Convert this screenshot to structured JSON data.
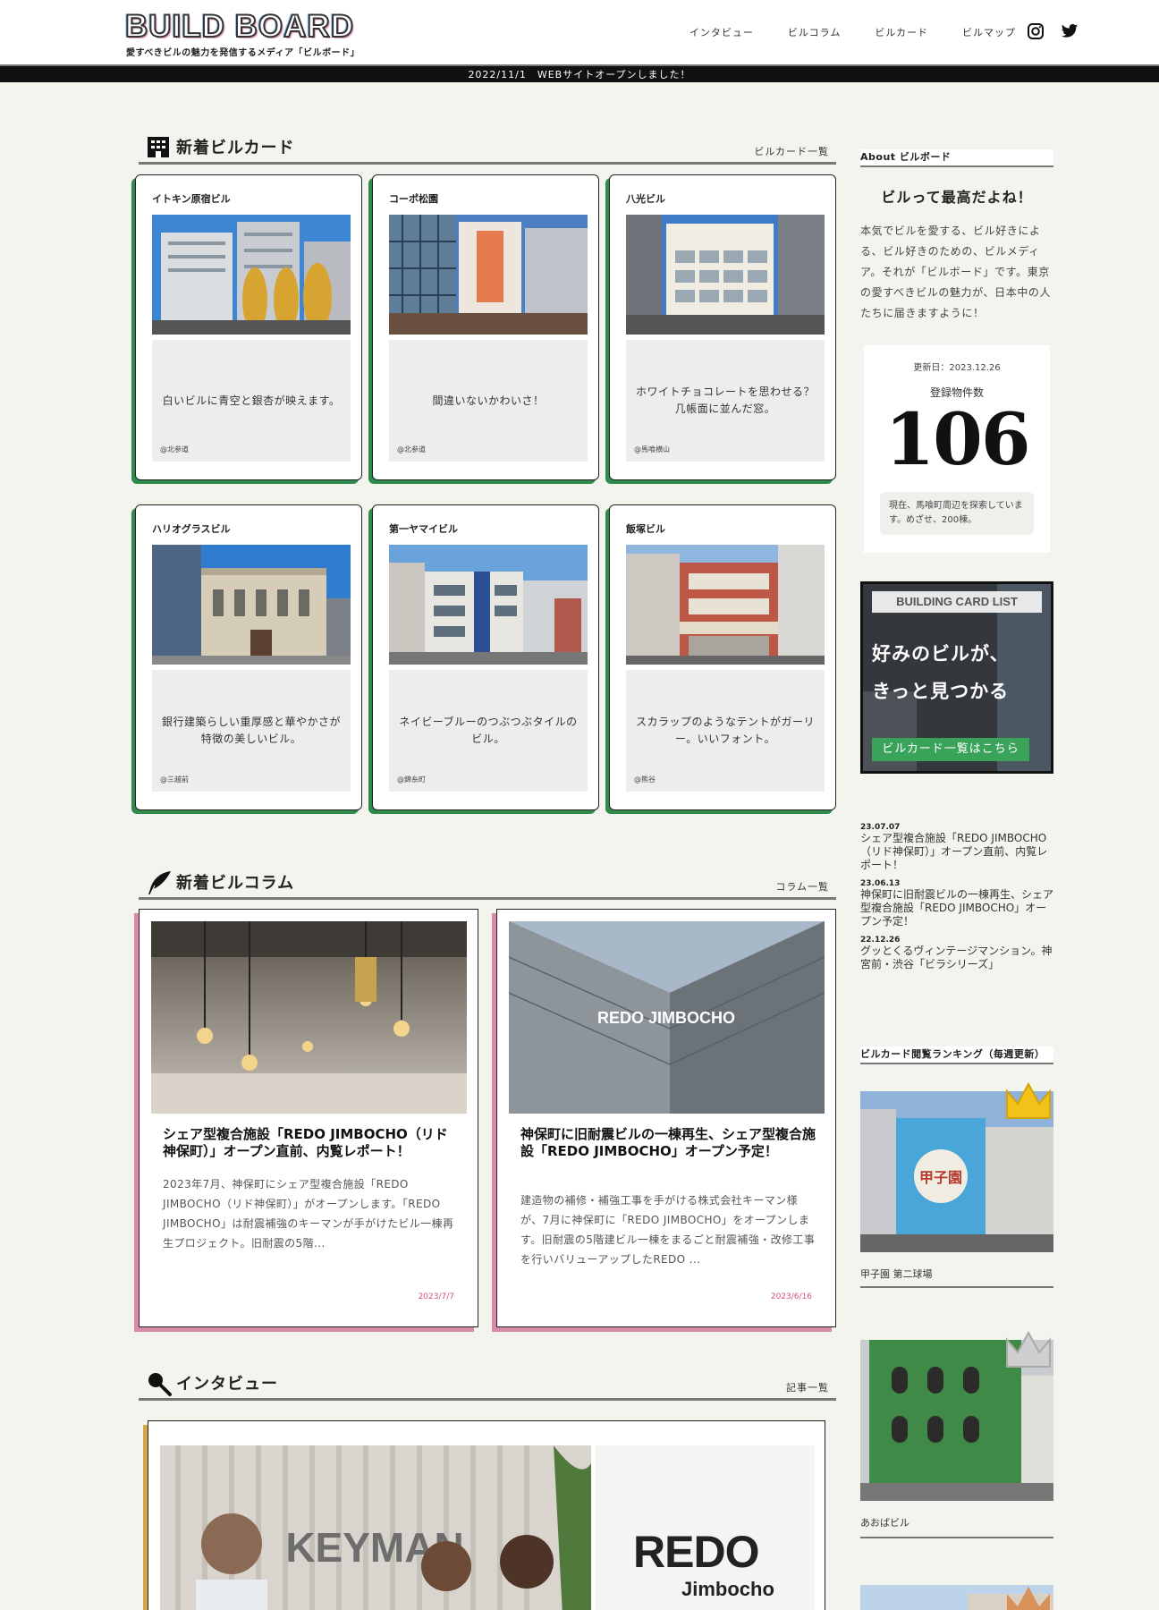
{
  "header": {
    "logo": "BUILD BOARD",
    "tagline": "愛すべきビルの魅力を発信するメディア「ビルボード」",
    "nav": [
      "インタビュー",
      "ビルコラム",
      "ビルカード",
      "ビルマップ"
    ],
    "announcement": "2022/11/1　WEBサイトオープンしました！"
  },
  "cards_section": {
    "title": "新着ビルカード",
    "more": "ビルカード一覧",
    "cards": [
      {
        "name": "イトキン原宿ビル",
        "desc": "白いビルに青空と銀杏が映えます。",
        "loc": "@北参道"
      },
      {
        "name": "コーポ松園",
        "desc": "間違いないかわいさ！",
        "loc": "@北参道"
      },
      {
        "name": "八光ビル",
        "desc": "ホワイトチョコレートを思わせる？几帳面に並んだ窓。",
        "loc": "@馬喰横山"
      },
      {
        "name": "ハリオグラスビル",
        "desc": "銀行建築らしい重厚感と華やかさが特徴の美しいビル。",
        "loc": "@三越前"
      },
      {
        "name": "第一ヤマイビル",
        "desc": "ネイビーブルーのつぶつぶタイルのビル。",
        "loc": "@錦糸町"
      },
      {
        "name": "飯塚ビル",
        "desc": "スカラップのようなテントがガーリー。いいフォント。",
        "loc": "@熊谷"
      }
    ]
  },
  "columns_section": {
    "title": "新着ビルコラム",
    "more": "コラム一覧",
    "columns": [
      {
        "title": "シェア型複合施設「REDO JIMBOCHO（リド神保町）」オープン直前、内覧レポート！",
        "body": "2023年7月、神保町にシェア型複合施設「REDO JIMBOCHO（リド神保町）」がオープンします。「REDO JIMBOCHO」は耐震補強のキーマンが手がけたビル一棟再生プロジェクト。旧耐震の5階...",
        "date": "2023/7/7",
        "image_text": ""
      },
      {
        "title": "神保町に旧耐震ビルの一棟再生、シェア型複合施設「REDO JIMBOCHO」オープン予定！",
        "body": "建造物の補修・補強工事を手がける株式会社キーマン様が、7月に神保町に「REDO JIMBOCHO」をオープンします。旧耐震の5階建ビル一棟をまるごと耐震補強・改修工事を行いバリューアップしたREDO ...",
        "date": "2023/6/16",
        "image_text": "REDO JIMBOCHO"
      }
    ]
  },
  "interview_section": {
    "title": "インタビュー",
    "more": "記事一覧",
    "sign_text": "KEYMAN",
    "logo_main": "REDO",
    "logo_sub": "Jimbocho"
  },
  "sidebar": {
    "about_title": "About ビルボード",
    "catch": "ビルって最高だよね！",
    "about_text": "本気でビルを愛する、ビル好きによる、ビル好きのための、ビルメディア。それが「ビルボード」です。東京の愛すべきビルの魅力が、日本中の人たちに届きますように！",
    "updated": "更新日：2023.12.26",
    "count_label": "登録物件数",
    "count": "106",
    "note": "現在、馬喰町周辺を探索しています。めざせ、200棟。",
    "banner_top": "BUILDING CARD LIST",
    "banner_line1": "好みのビルが、",
    "banner_line2": "きっと見つかる",
    "banner_cta": "ビルカード一覧はこちら",
    "news": [
      {
        "date": "23.07.07",
        "text": "シェア型複合施設「REDO JIMBOCHO（リド神保町）」オープン直前、内覧レポート！"
      },
      {
        "date": "23.06.13",
        "text": "神保町に旧耐震ビルの一棟再生、シェア型複合施設「REDO JIMBOCHO」オープン予定！"
      },
      {
        "date": "22.12.26",
        "text": "グッとくるヴィンテージマンション。神宮前・渋谷「ビラシリーズ」"
      }
    ],
    "ranking_title": "ビルカード閲覧ランキング（毎週更新）",
    "ranking": [
      {
        "name": "甲子園 第二球場",
        "sign": "甲子園",
        "crown": "#f2c21b"
      },
      {
        "name": "あおばビル",
        "crown": "#cfcfcf"
      }
    ]
  },
  "colors": {
    "card_accent": "#2e8b4b",
    "column_accent": "#d98aa8",
    "interview_accent": "#d4a64c",
    "date": "#d64e87"
  }
}
